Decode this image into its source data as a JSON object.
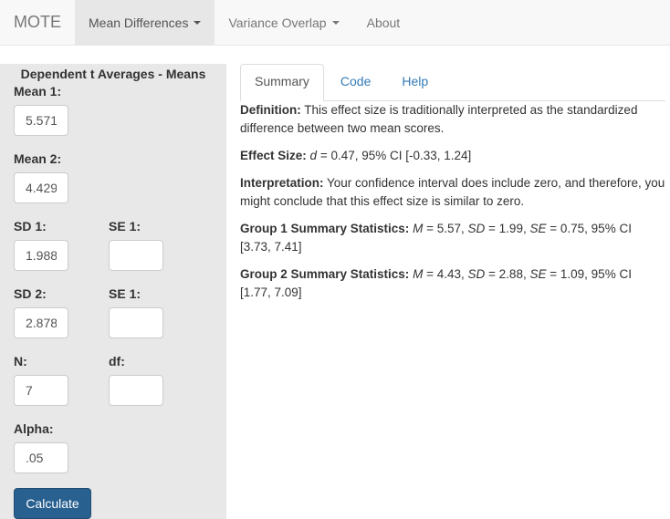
{
  "navbar": {
    "brand": "MOTE",
    "items": [
      {
        "label": "Mean Differences",
        "dropdown": true,
        "active": true
      },
      {
        "label": "Variance Overlap",
        "dropdown": true,
        "active": false
      },
      {
        "label": "About",
        "dropdown": false,
        "active": false
      }
    ]
  },
  "sidebar": {
    "title": "Dependent t Averages - Means",
    "fields": {
      "mean1": {
        "label": "Mean 1:",
        "value": "5.571"
      },
      "mean2": {
        "label": "Mean 2:",
        "value": "4.429"
      },
      "sd1": {
        "label": "SD 1:",
        "value": "1.988"
      },
      "se1": {
        "label": "SE 1:",
        "value": ""
      },
      "sd2": {
        "label": "SD 2:",
        "value": "2.878"
      },
      "se2": {
        "label": "SE 1:",
        "value": ""
      },
      "n": {
        "label": "N:",
        "value": "7"
      },
      "df": {
        "label": "df:",
        "value": ""
      },
      "alpha": {
        "label": "Alpha:",
        "value": ".05"
      }
    },
    "calculate_label": "Calculate"
  },
  "main": {
    "tabs": [
      {
        "label": "Summary",
        "active": true
      },
      {
        "label": "Code",
        "active": false
      },
      {
        "label": "Help",
        "active": false
      }
    ],
    "summary": {
      "definition_label": "Definition:",
      "definition_text": " This effect size is traditionally interpreted as the standardized difference between two mean scores.",
      "effect_label": "Effect Size:",
      "effect_symbol": "d",
      "effect_text": " = 0.47, 95% CI [-0.33, 1.24]",
      "interpretation_label": "Interpretation:",
      "interpretation_text": " Your confidence interval does include zero, and therefore, you might conclude that this effect size is similar to zero.",
      "group1": {
        "label": "Group 1 Summary Statistics:",
        "M": "5.57",
        "SD": "1.99",
        "SE": "0.75",
        "CI": "95% CI [3.73, 7.41]"
      },
      "group2": {
        "label": "Group 2 Summary Statistics:",
        "M": "4.43",
        "SD": "2.88",
        "SE": "1.09",
        "CI": "95% CI [1.77, 7.09]"
      }
    }
  }
}
